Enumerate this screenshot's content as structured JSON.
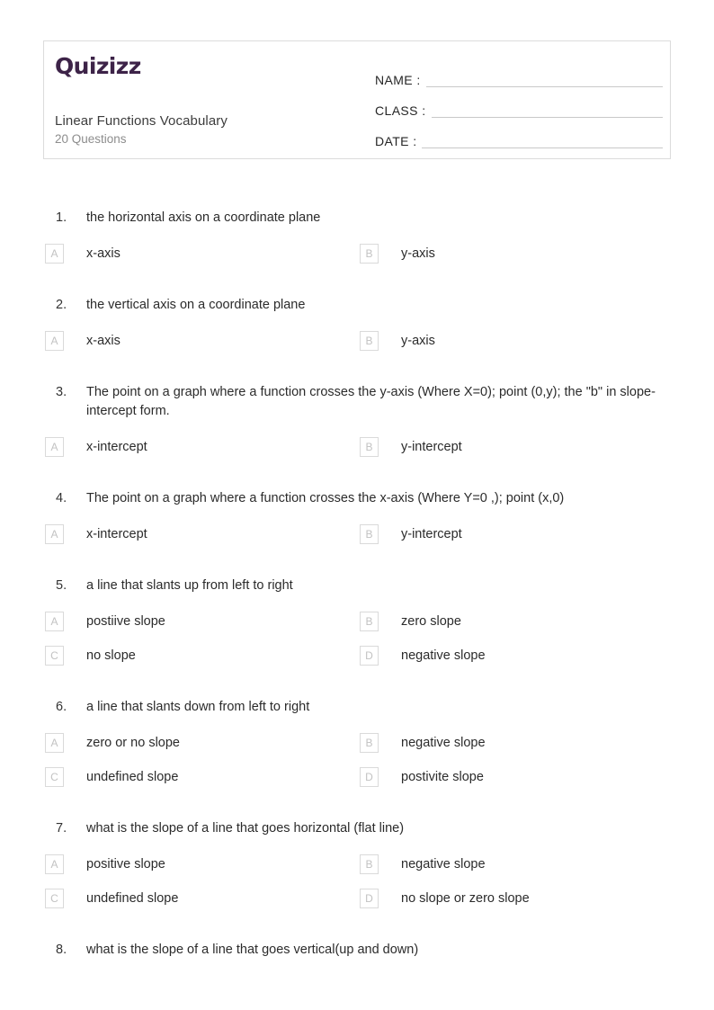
{
  "header": {
    "logo_text": "Quizizz",
    "logo_color": "#3d2348",
    "title": "Linear Functions Vocabulary",
    "subtitle": "20 Questions",
    "fields": [
      {
        "label": "NAME :",
        "value": ""
      },
      {
        "label": "CLASS :",
        "value": ""
      },
      {
        "label": "DATE  :",
        "value": ""
      }
    ]
  },
  "questions": [
    {
      "number": "1.",
      "text": "the horizontal axis on a coordinate plane",
      "options": [
        {
          "letter": "A",
          "text": "x-axis"
        },
        {
          "letter": "B",
          "text": "y-axis"
        }
      ]
    },
    {
      "number": "2.",
      "text": "the vertical axis on a coordinate plane",
      "options": [
        {
          "letter": "A",
          "text": "x-axis"
        },
        {
          "letter": "B",
          "text": "y-axis"
        }
      ]
    },
    {
      "number": "3.",
      "text": "The point on a graph where a function crosses the y-axis (Where X=0); point (0,y); the \"b\" in slope-intercept form.",
      "options": [
        {
          "letter": "A",
          "text": "x-intercept"
        },
        {
          "letter": "B",
          "text": "y-intercept"
        }
      ]
    },
    {
      "number": "4.",
      "text": "The point on a graph where a function crosses the x-axis (Where Y=0 ,); point (x,0)",
      "options": [
        {
          "letter": "A",
          "text": "x-intercept"
        },
        {
          "letter": "B",
          "text": "y-intercept"
        }
      ]
    },
    {
      "number": "5.",
      "text": "a line that slants up from left to right",
      "options": [
        {
          "letter": "A",
          "text": "postiive slope"
        },
        {
          "letter": "B",
          "text": "zero slope"
        },
        {
          "letter": "C",
          "text": "no slope"
        },
        {
          "letter": "D",
          "text": "negative slope"
        }
      ]
    },
    {
      "number": "6.",
      "text": "a line that slants down from left to right",
      "options": [
        {
          "letter": "A",
          "text": "zero or no slope"
        },
        {
          "letter": "B",
          "text": "negative slope"
        },
        {
          "letter": "C",
          "text": "undefined slope"
        },
        {
          "letter": "D",
          "text": "postivite slope"
        }
      ]
    },
    {
      "number": "7.",
      "text": "what is the slope of a line that goes horizontal (flat line)",
      "options": [
        {
          "letter": "A",
          "text": "positive slope"
        },
        {
          "letter": "B",
          "text": "negative slope"
        },
        {
          "letter": "C",
          "text": "undefined slope"
        },
        {
          "letter": "D",
          "text": "no slope or zero slope"
        }
      ]
    },
    {
      "number": "8.",
      "text": "what is the slope of a line that goes vertical(up and down)",
      "options": []
    }
  ]
}
